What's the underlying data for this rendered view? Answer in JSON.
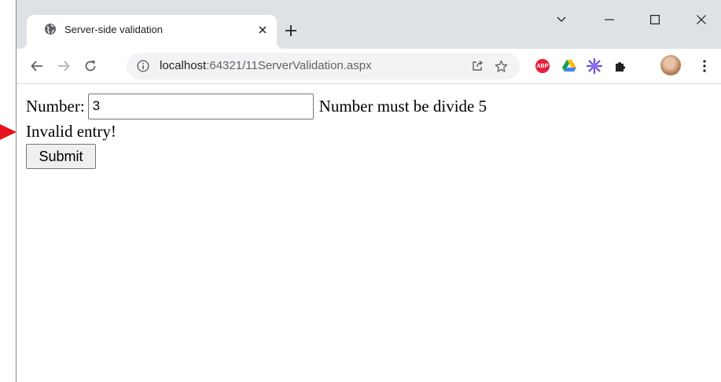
{
  "tab": {
    "title": "Server-side validation"
  },
  "address_bar": {
    "host": "localhost",
    "path": ":64321/11ServerValidation.aspx"
  },
  "extensions": {
    "abp_label": "ABP"
  },
  "form": {
    "number_label": "Number:",
    "number_value": "3",
    "validator_message": "Number must be divide 5",
    "invalid_message": "Invalid entry!",
    "submit_label": "Submit"
  },
  "colors": {
    "arrow": "#e8121a",
    "titlebar": "#dee1e6",
    "omnibox": "#f1f3f4"
  }
}
